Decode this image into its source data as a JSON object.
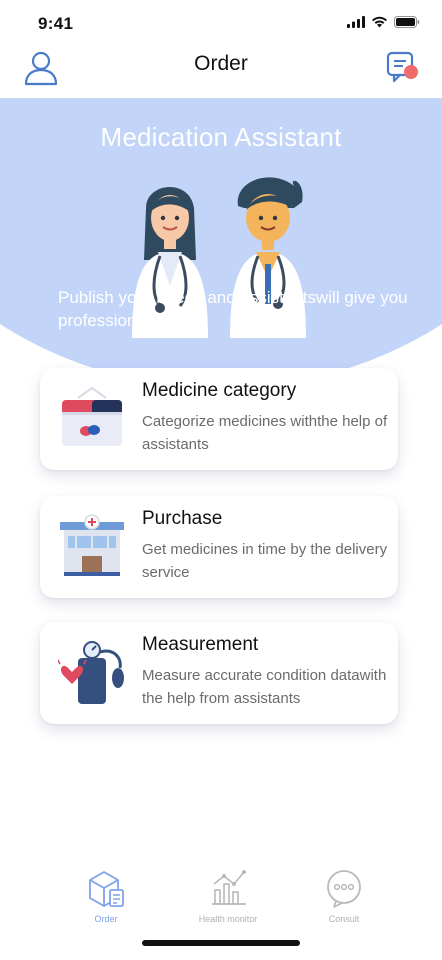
{
  "status_bar": {
    "time": "9:41"
  },
  "nav": {
    "title": "Order",
    "icons": {
      "left": "user-profile-icon",
      "right": "message-icon"
    }
  },
  "hero": {
    "title": "Medication Assistant",
    "subtitle": "Publish your needs and assistantswill give you professional help",
    "background_color": "#c3d4f9"
  },
  "cards": [
    {
      "title": "Medicine category",
      "description": "Categorize medicines withthe help of assistants",
      "icon": "medicine-box-icon"
    },
    {
      "title": "Purchase",
      "description": "Get medicines in time by the delivery service",
      "icon": "pharmacy-store-icon"
    },
    {
      "title": "Measurement",
      "description": "Measure accurate condition datawith the help from assistants",
      "icon": "blood-pressure-monitor-icon"
    }
  ],
  "tab_bar": {
    "tabs": [
      {
        "label": "Order",
        "icon": "order-box-icon",
        "active": true
      },
      {
        "label": "Health monitor",
        "icon": "health-chart-icon",
        "active": false
      },
      {
        "label": "Consult",
        "icon": "consult-chat-icon",
        "active": false
      }
    ]
  },
  "colors": {
    "accent": "#7fa2ea",
    "text_secondary": "#6b6b6b",
    "tab_inactive": "#b0b0b0"
  }
}
